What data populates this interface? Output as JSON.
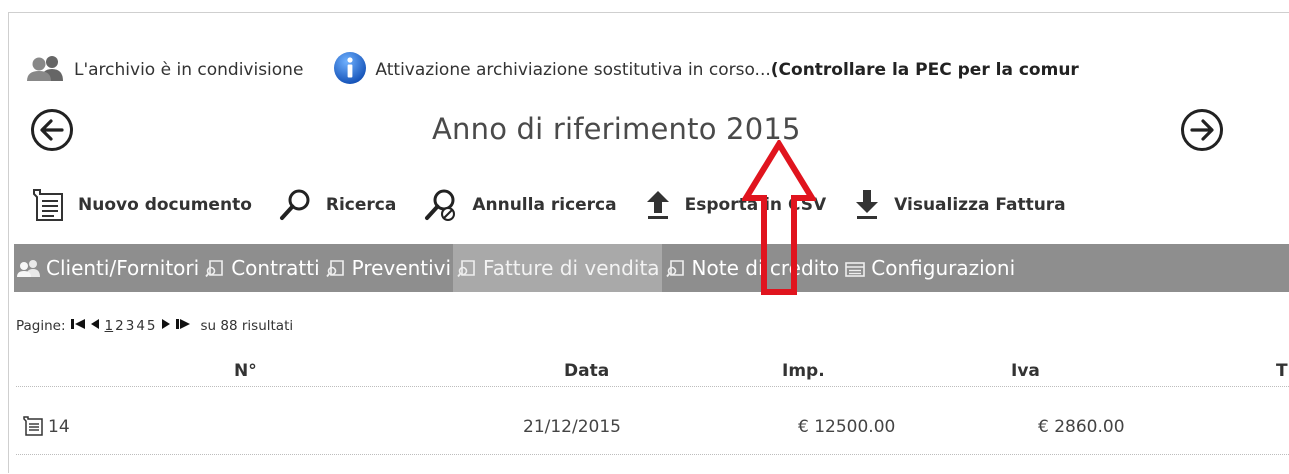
{
  "status": {
    "shared_text": "L'archivio è in condivisione",
    "activation_text": "Attivazione archiviazione sostitutiva in corso... ",
    "activation_bold": "(Controllare la PEC per la comur"
  },
  "year_nav": {
    "title": "Anno di riferimento 2015"
  },
  "toolbar": {
    "new_doc": "Nuovo documento",
    "search": "Ricerca",
    "cancel_search": "Annulla ricerca",
    "export_csv": "Esporta in CSV",
    "view_invoices": "Visualizza Fattura"
  },
  "tabs": [
    {
      "label": "Clienti/Fornitori",
      "icon": "users-icon"
    },
    {
      "label": "Contratti",
      "icon": "document-search-icon"
    },
    {
      "label": "Preventivi",
      "icon": "document-search-icon"
    },
    {
      "label": "Fatture di vendita",
      "icon": "document-search-icon",
      "active": true
    },
    {
      "label": "Note di credito",
      "icon": "document-search-icon"
    },
    {
      "label": "Configurazioni",
      "icon": "list-icon"
    }
  ],
  "pager": {
    "label": "Pagine:",
    "pages": [
      "1",
      "2",
      "3",
      "4",
      "5"
    ],
    "current_page": "1",
    "results": "su 88 risultati"
  },
  "table": {
    "columns": [
      "N°",
      "Data",
      "Imp.",
      "Iva",
      "T"
    ],
    "rows": [
      {
        "n": "14",
        "data": "21/12/2015",
        "imp": "€ 12500.00",
        "iva": "€ 2860.00"
      }
    ]
  },
  "colors": {
    "tab_bar": "#8e8e8e",
    "tab_active": "#a9a9a9",
    "info_blue": "#1f6fd1",
    "annotation_red": "#e0141e"
  }
}
